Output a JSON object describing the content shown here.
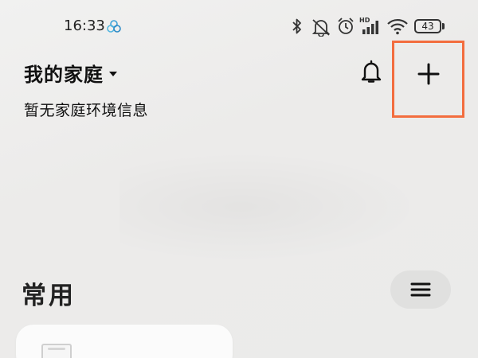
{
  "status_bar": {
    "time": "16:33",
    "battery_level": "43",
    "icons": [
      "app-notification-icon",
      "bluetooth-icon",
      "mute-icon",
      "alarm-icon",
      "hd-signal-icon",
      "wifi-icon",
      "battery-icon"
    ]
  },
  "header": {
    "home_title": "我的家庭",
    "subtitle": "暂无家庭环境信息",
    "notification_icon": "bell-icon",
    "add_icon": "plus-icon"
  },
  "section": {
    "title": "常用",
    "menu_icon": "menu-icon"
  },
  "colors": {
    "highlight_border": "#f36d3e",
    "background": "#ececeb",
    "menu_button_bg": "#e0e0df"
  }
}
